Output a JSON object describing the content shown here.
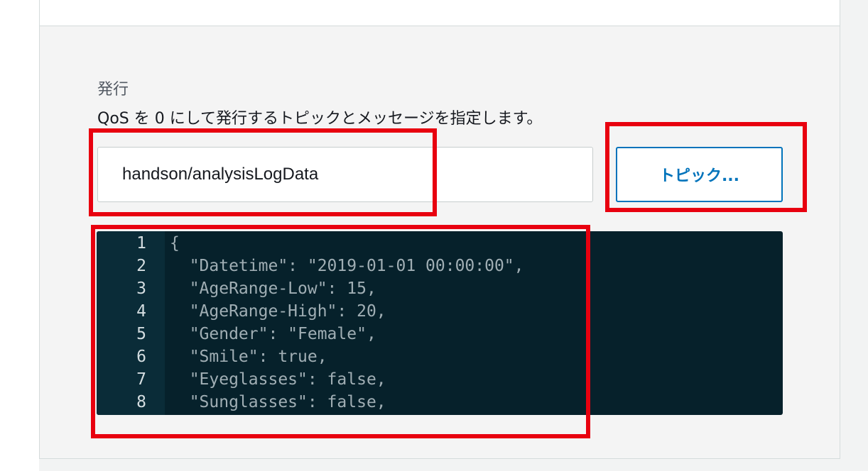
{
  "publish": {
    "title": "発行",
    "description": "QoS を 0 にして発行するトピックとメッセージを指定します。",
    "topic_value": "handson/analysisLogData",
    "topic_button_label": "トピック..."
  },
  "editor": {
    "lines": [
      {
        "number": "1",
        "text": "{"
      },
      {
        "number": "2",
        "text": "  \"Datetime\": \"2019-01-01 00:00:00\","
      },
      {
        "number": "3",
        "text": "  \"AgeRange-Low\": 15,"
      },
      {
        "number": "4",
        "text": "  \"AgeRange-High\": 20,"
      },
      {
        "number": "5",
        "text": "  \"Gender\": \"Female\","
      },
      {
        "number": "6",
        "text": "  \"Smile\": true,"
      },
      {
        "number": "7",
        "text": "  \"Eyeglasses\": false,"
      },
      {
        "number": "8",
        "text": "  \"Sunglasses\": false,"
      }
    ]
  },
  "colors": {
    "accent": "#0073bb",
    "annotation": "#e8000f",
    "editor_bg": "#06212b"
  }
}
